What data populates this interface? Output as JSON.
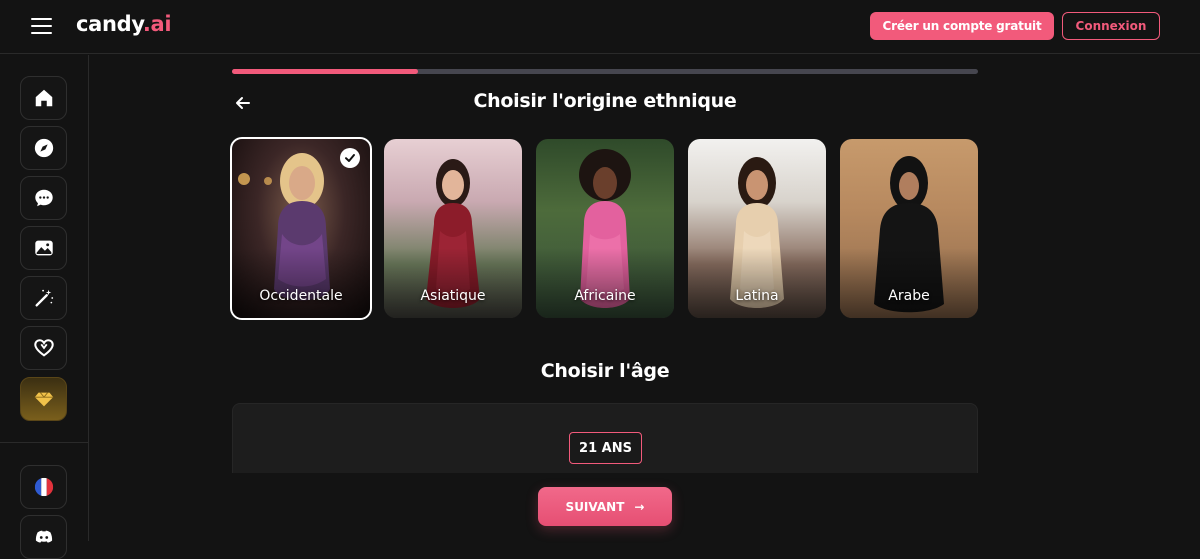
{
  "header": {
    "logo_main": "candy",
    "logo_suffix": ".ai",
    "signup_label": "Créer un compte gratuit",
    "login_label": "Connexion"
  },
  "sidebar": {
    "items": [
      {
        "name": "home",
        "icon": "home-icon"
      },
      {
        "name": "explore",
        "icon": "compass-icon"
      },
      {
        "name": "chat",
        "icon": "chat-icon"
      },
      {
        "name": "gallery",
        "icon": "image-icon"
      },
      {
        "name": "generate",
        "icon": "magic-wand-icon"
      },
      {
        "name": "create",
        "icon": "heart-icon"
      },
      {
        "name": "premium",
        "icon": "diamond-icon"
      }
    ],
    "bottom": [
      {
        "name": "language",
        "icon": "french-flag-icon"
      },
      {
        "name": "discord",
        "icon": "discord-icon"
      }
    ]
  },
  "progress": {
    "value": 0.25
  },
  "ethnicity": {
    "title": "Choisir l'origine ethnique",
    "options": [
      {
        "label": "Occidentale",
        "selected": true
      },
      {
        "label": "Asiatique",
        "selected": false
      },
      {
        "label": "Africaine",
        "selected": false
      },
      {
        "label": "Latina",
        "selected": false
      },
      {
        "label": "Arabe",
        "selected": false
      }
    ]
  },
  "age": {
    "title": "Choisir l'âge",
    "value": "21 ANS"
  },
  "next_label": "SUIVANT",
  "colors": {
    "accent": "#f25a7b",
    "background": "#131313"
  }
}
